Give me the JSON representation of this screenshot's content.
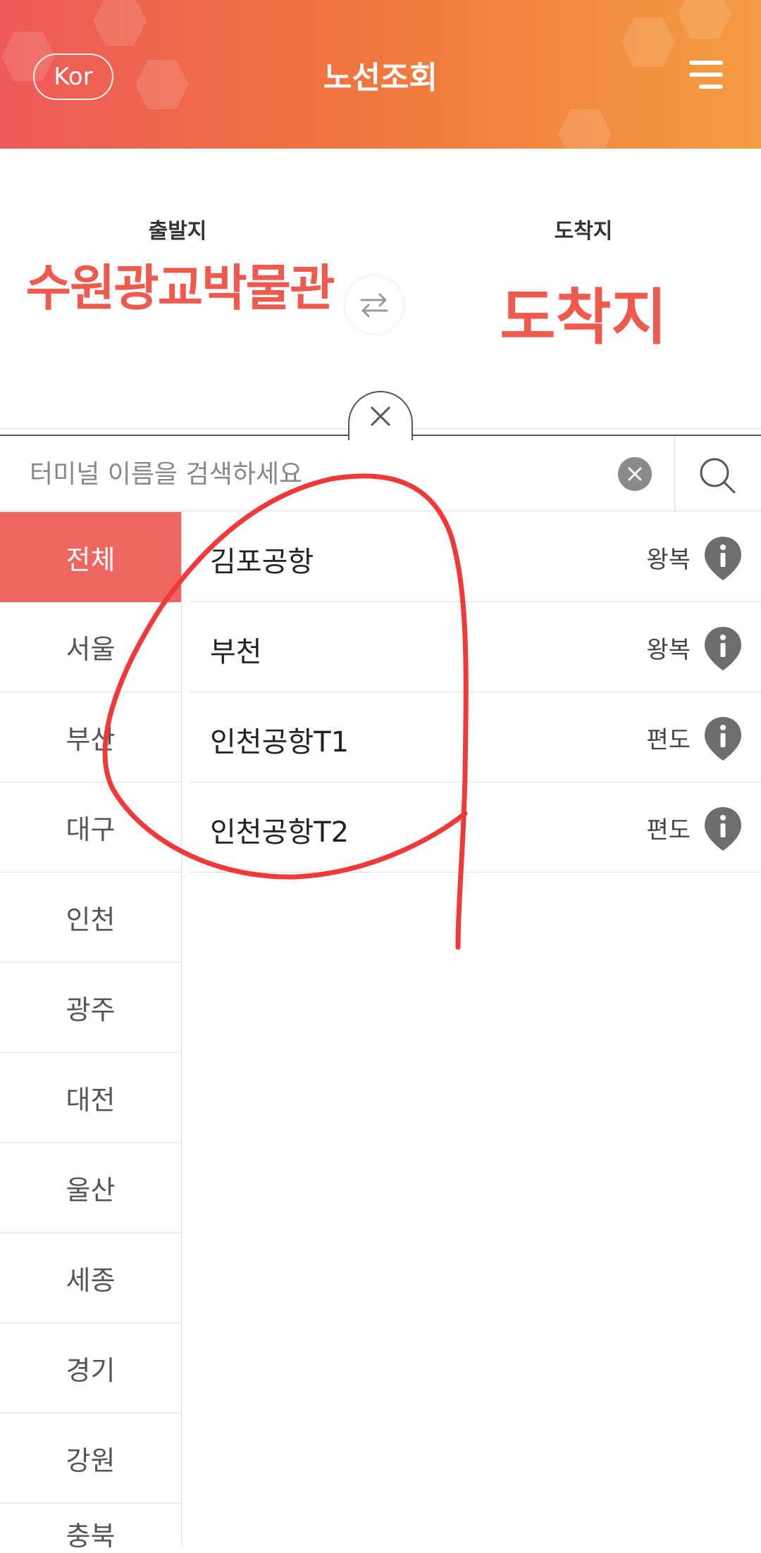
{
  "header": {
    "lang_label": "Kor",
    "title": "노선조회"
  },
  "route": {
    "origin_label": "출발지",
    "origin_value": "수원광교박물관",
    "dest_label": "도착지",
    "dest_value": "도착지"
  },
  "search": {
    "placeholder": "터미널 이름을 검색하세요"
  },
  "regions": [
    "전체",
    "서울",
    "부산",
    "대구",
    "인천",
    "광주",
    "대전",
    "울산",
    "세종",
    "경기",
    "강원",
    "충북"
  ],
  "active_region": "전체",
  "terminals": [
    {
      "name": "김포공항",
      "type": "왕복"
    },
    {
      "name": "부천",
      "type": "왕복"
    },
    {
      "name": "인천공항T1",
      "type": "편도"
    },
    {
      "name": "인천공항T2",
      "type": "편도"
    }
  ],
  "colors": {
    "accent": "#ef5a4f",
    "header_start": "#ee5a5a",
    "header_end": "#f49c42",
    "annotation": "#f03a3a"
  },
  "icons": [
    "menu-icon",
    "swap-icon",
    "close-icon",
    "clear-icon",
    "search-icon",
    "info-icon"
  ]
}
